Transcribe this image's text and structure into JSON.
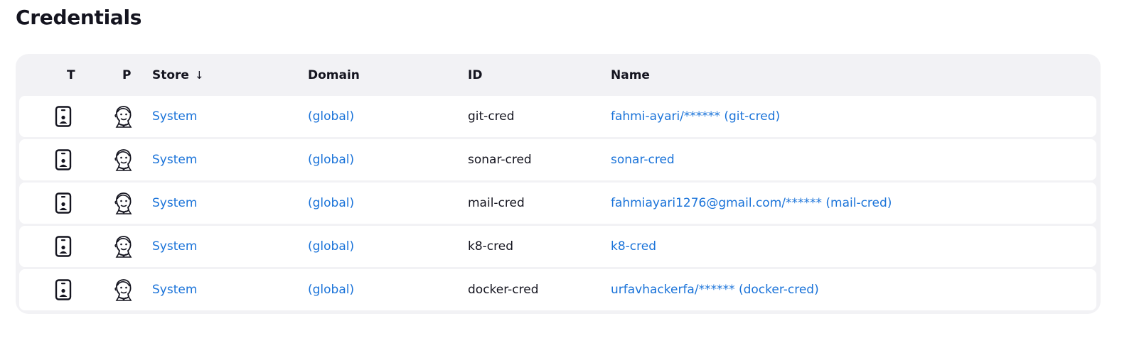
{
  "page": {
    "title": "Credentials"
  },
  "table": {
    "columns": {
      "type": "T",
      "provider": "P",
      "store": "Store",
      "store_sort_indicator": "↓",
      "domain": "Domain",
      "id": "ID",
      "name": "Name"
    },
    "rows": [
      {
        "type_icon": "credential-card-icon",
        "provider_icon": "jenkins-provider-icon",
        "store": "System",
        "domain": "(global)",
        "id": "git-cred",
        "name": "fahmi-ayari/****** (git-cred)"
      },
      {
        "type_icon": "credential-card-icon",
        "provider_icon": "jenkins-provider-icon",
        "store": "System",
        "domain": "(global)",
        "id": "sonar-cred",
        "name": "sonar-cred"
      },
      {
        "type_icon": "credential-card-icon",
        "provider_icon": "jenkins-provider-icon",
        "store": "System",
        "domain": "(global)",
        "id": "mail-cred",
        "name": "fahmiayari1276@gmail.com/****** (mail-cred)"
      },
      {
        "type_icon": "credential-card-icon",
        "provider_icon": "jenkins-provider-icon",
        "store": "System",
        "domain": "(global)",
        "id": "k8-cred",
        "name": "k8-cred"
      },
      {
        "type_icon": "credential-card-icon",
        "provider_icon": "jenkins-provider-icon",
        "store": "System",
        "domain": "(global)",
        "id": "docker-cred",
        "name": "urfavhackerfa/****** (docker-cred)"
      }
    ]
  },
  "colors": {
    "link": "#1a73d9",
    "table_background": "#f2f2f5",
    "row_background": "#ffffff",
    "text": "#14141f"
  }
}
